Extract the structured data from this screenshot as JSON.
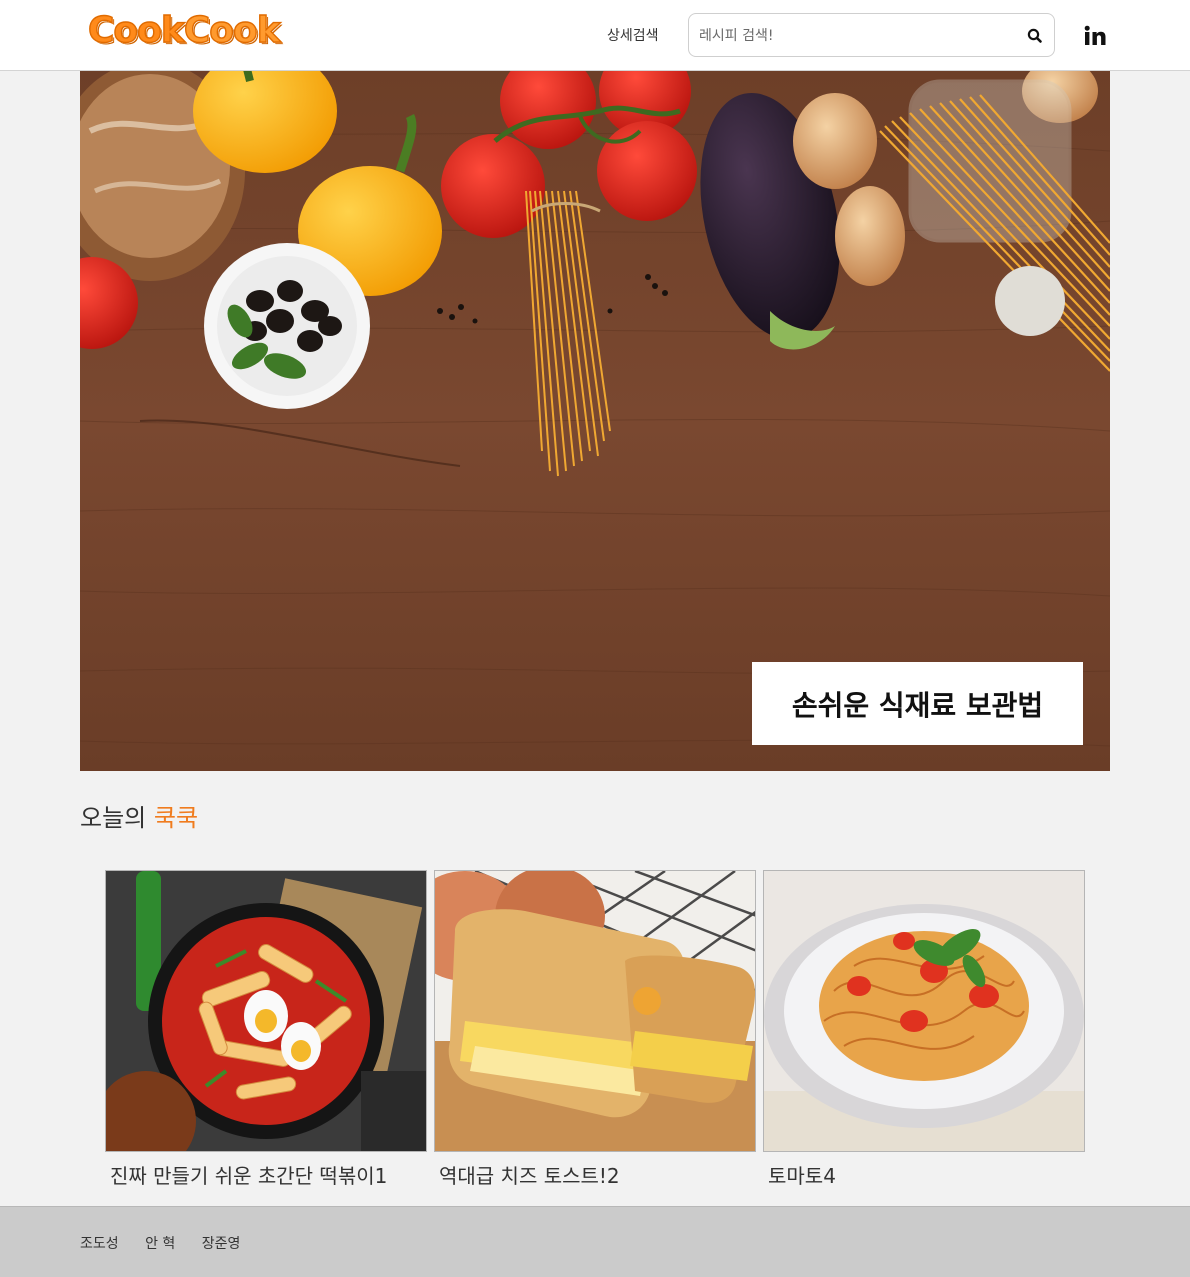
{
  "header": {
    "logo_text_1": "Cook",
    "logo_text_2": "Cook",
    "detail_search_label": "상세검색",
    "search_placeholder": "레시피 검색!",
    "search_icon": "search-icon",
    "social_icon": "linkedin-icon"
  },
  "hero": {
    "caption": "손쉬운 식재료 보관법"
  },
  "section": {
    "title_prefix": "오늘의",
    "title_accent": "쿡쿡"
  },
  "recipes": [
    {
      "title": "진짜 만들기 쉬운 초간단 떡볶이1"
    },
    {
      "title": "역대급 치즈 토스트!2"
    },
    {
      "title": "토마토4"
    }
  ],
  "footer": {
    "authors": [
      "조도성",
      "안 혁",
      "장준영"
    ]
  },
  "colors": {
    "accent": "#f07c1e",
    "logo": "#ff8a1a",
    "background": "#f2f2f2",
    "footer": "#cbcbcb"
  }
}
